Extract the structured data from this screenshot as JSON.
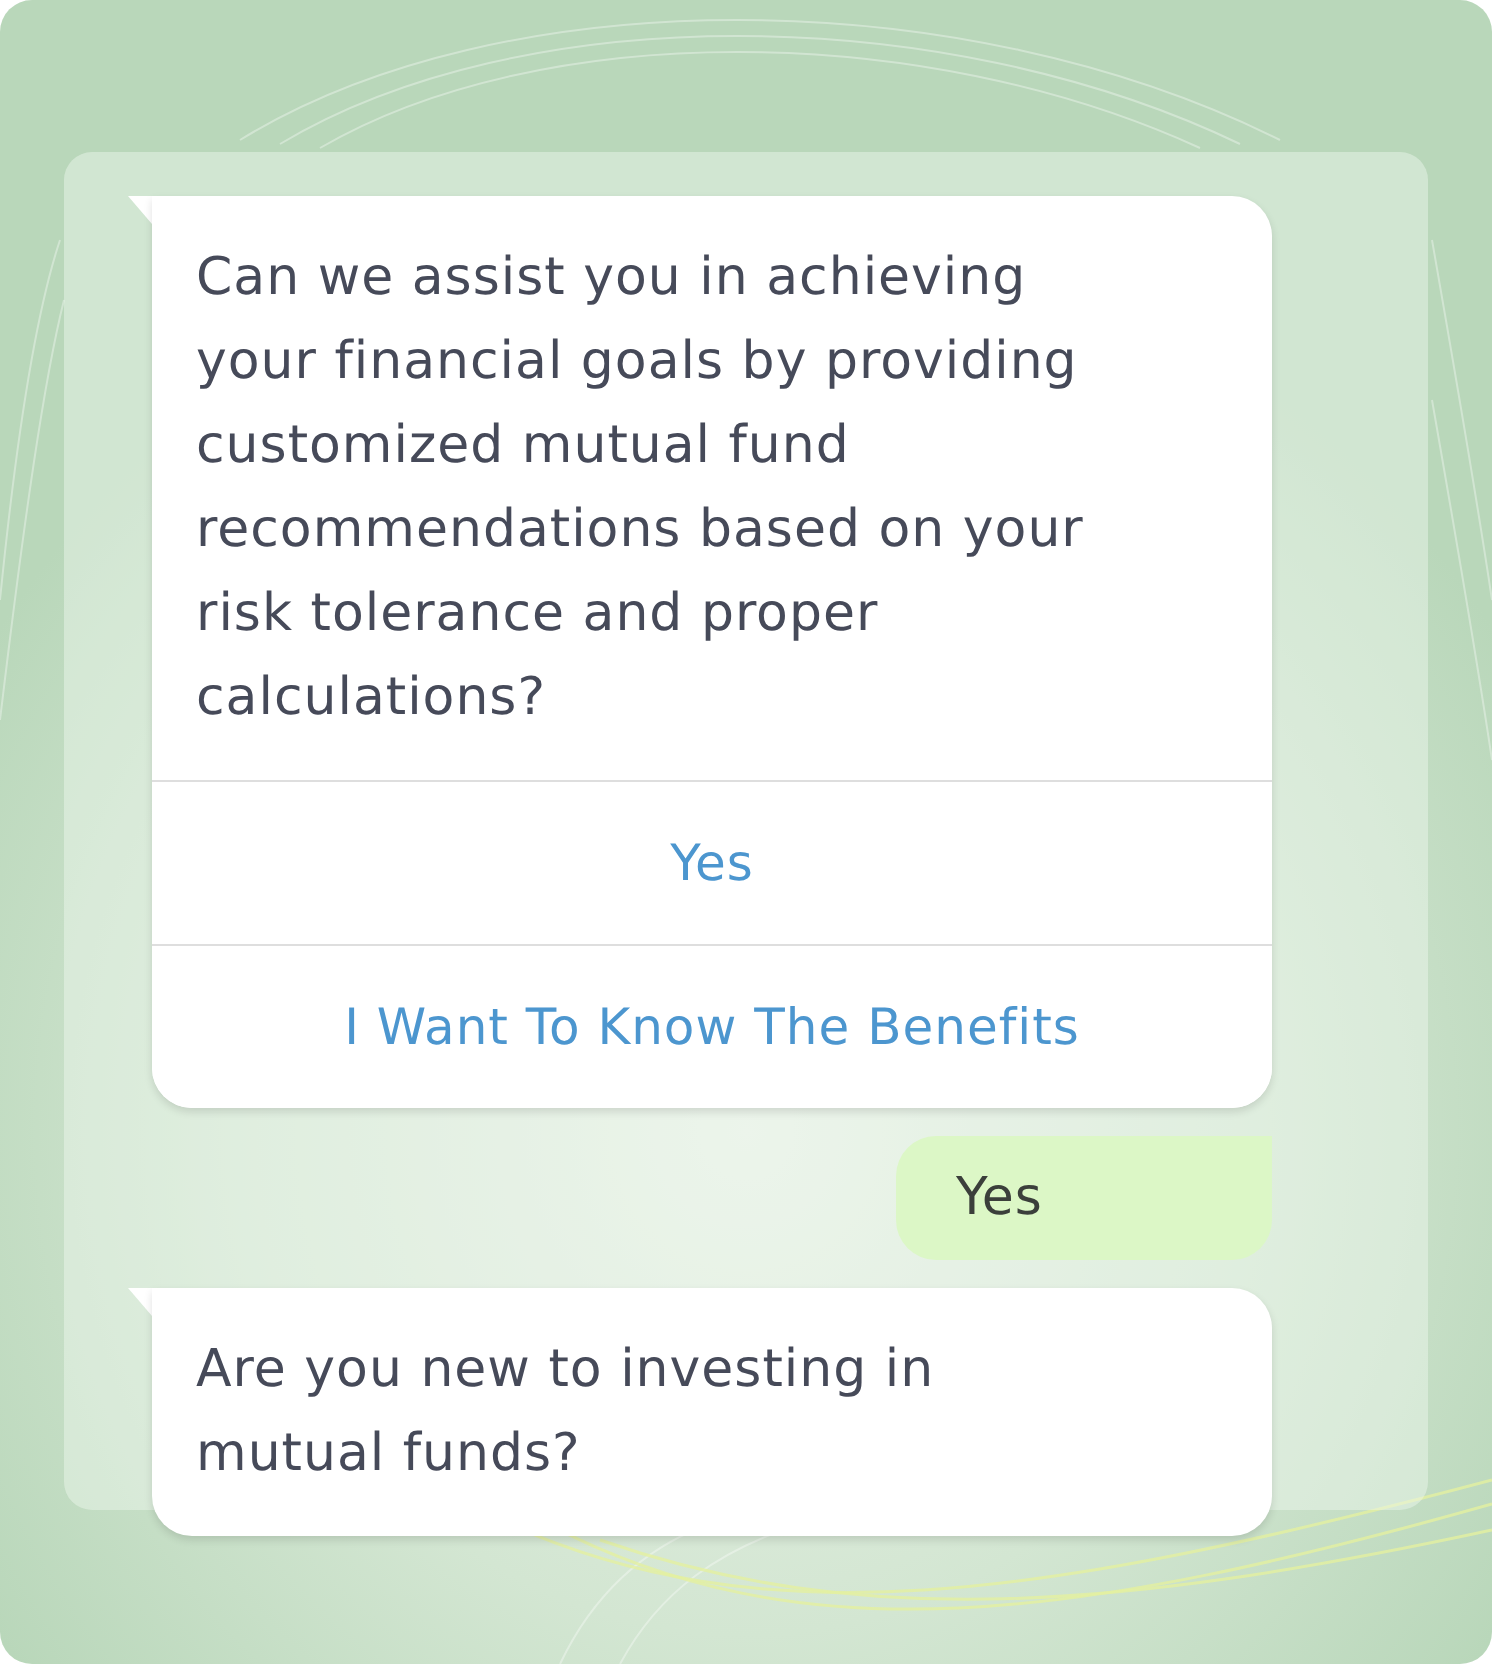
{
  "messages": [
    {
      "kind": "bot",
      "text": "Can we assist you in achieving your financial goals by providing customized mutual fund recommendations based on your risk tolerance and proper calculations?",
      "options": [
        {
          "label": "Yes"
        },
        {
          "label": "I Want To Know The Benefits"
        }
      ]
    },
    {
      "kind": "user",
      "text": "Yes"
    },
    {
      "kind": "bot",
      "text": "Are you new to investing in mutual funds?"
    }
  ]
}
